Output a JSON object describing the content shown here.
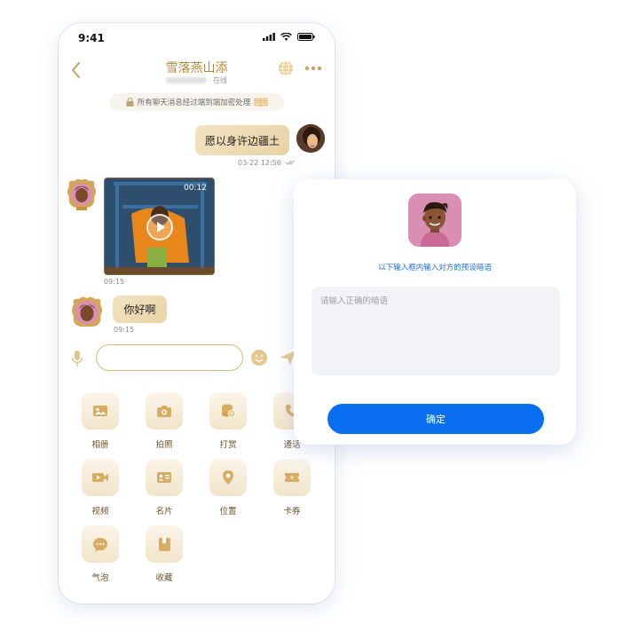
{
  "status_bar": {
    "time": "9:41"
  },
  "chat": {
    "title": "雪落燕山添",
    "status": "· 在线",
    "encryption_notice": "所有聊天消息经过端到端加密处理",
    "messages": [
      {
        "from": "me",
        "type": "text",
        "text": "愿以身许边疆土",
        "time": "03-22 12:56"
      },
      {
        "from": "other",
        "type": "video",
        "duration": "00:12",
        "time": "09:15"
      },
      {
        "from": "other",
        "type": "text",
        "text": "你好啊",
        "time": "09:15"
      }
    ]
  },
  "tools": [
    {
      "label": "相册",
      "icon": "photo-album-icon"
    },
    {
      "label": "拍照",
      "icon": "camera-icon"
    },
    {
      "label": "打赏",
      "icon": "coins-icon"
    },
    {
      "label": "通话",
      "icon": "phone-icon"
    },
    {
      "label": "视频",
      "icon": "video-icon"
    },
    {
      "label": "名片",
      "icon": "business-card-icon"
    },
    {
      "label": "位置",
      "icon": "location-icon"
    },
    {
      "label": "卡券",
      "icon": "coupon-icon"
    },
    {
      "label": "气泡",
      "icon": "bubble-icon"
    },
    {
      "label": "收藏",
      "icon": "bookmark-icon"
    }
  ],
  "dialog": {
    "hint": "以下输入框内输入对方的预设暗语",
    "placeholder": "请输入正确的暗语",
    "confirm_label": "确定"
  },
  "colors": {
    "accent_gold": "#b48a3c",
    "primary_blue": "#0a6ef0"
  }
}
